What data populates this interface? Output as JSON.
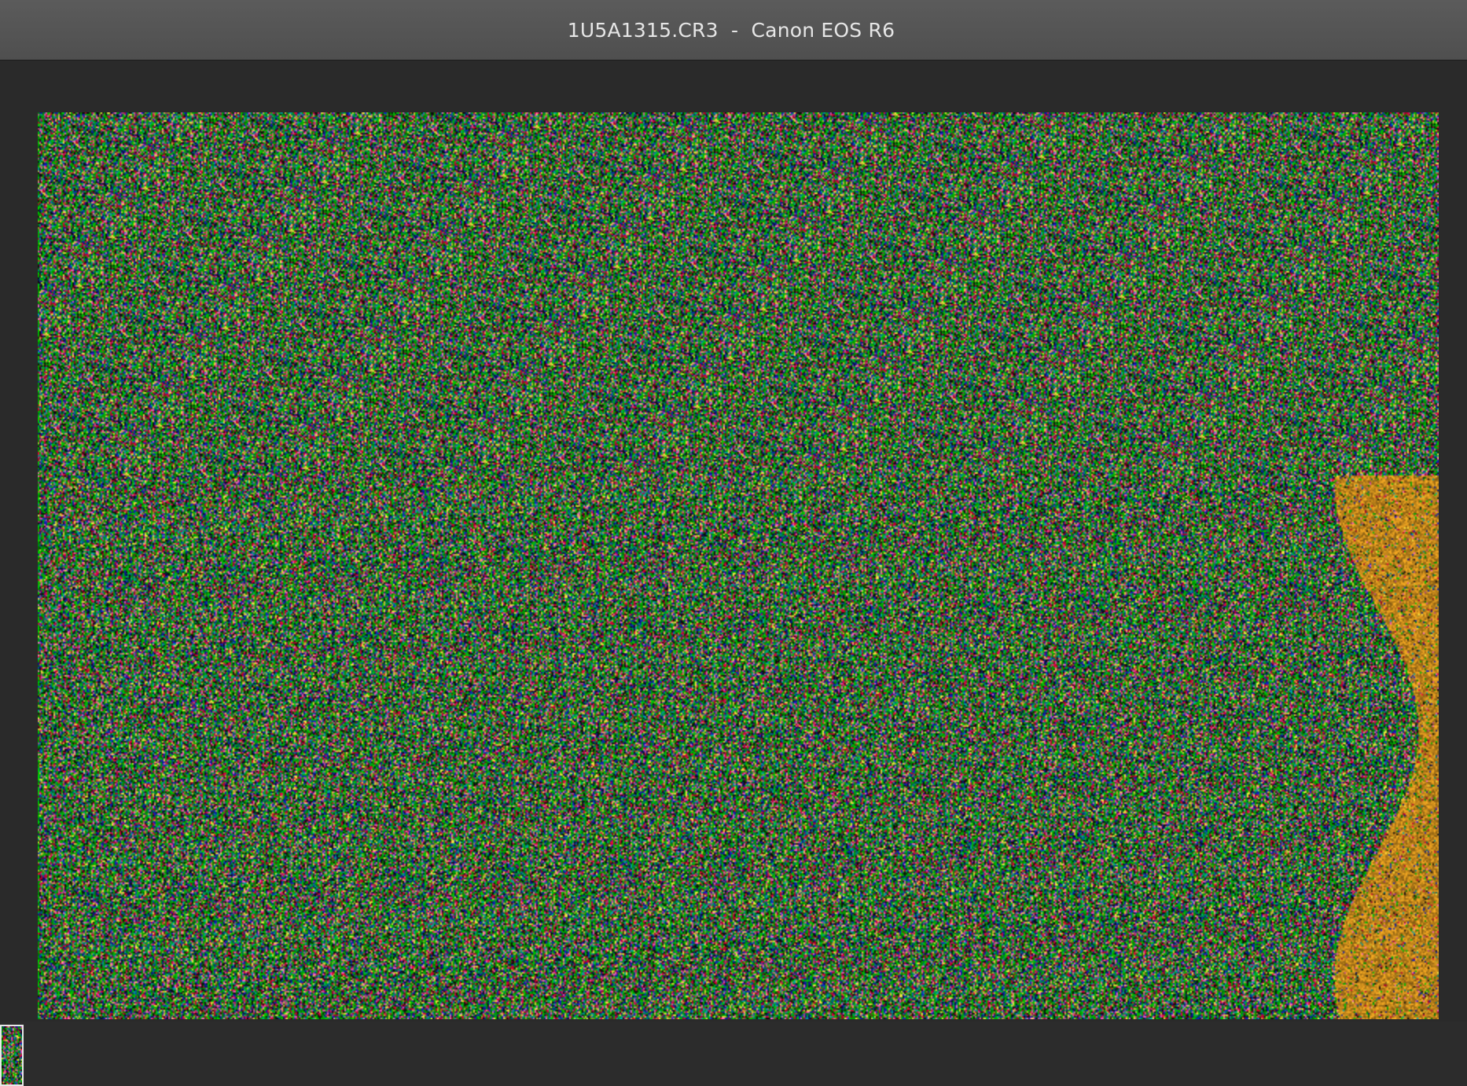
{
  "window": {
    "title": "1U5A1315.CR3  -  Canon EOS R6"
  },
  "viewer": {
    "image_alt": "1U5A1315.CR3",
    "colors": {
      "background": "#2a2a2a",
      "titlebar": "#555555",
      "noise_palette": [
        "#00c000",
        "#e0003a",
        "#1020c0",
        "#00a0a0",
        "#f0e040",
        "#ff60c0",
        "#101010"
      ],
      "right_edge_accent": "#e8a020"
    }
  },
  "filmstrip": {
    "thumbnails": [
      {
        "selected": true
      }
    ]
  }
}
